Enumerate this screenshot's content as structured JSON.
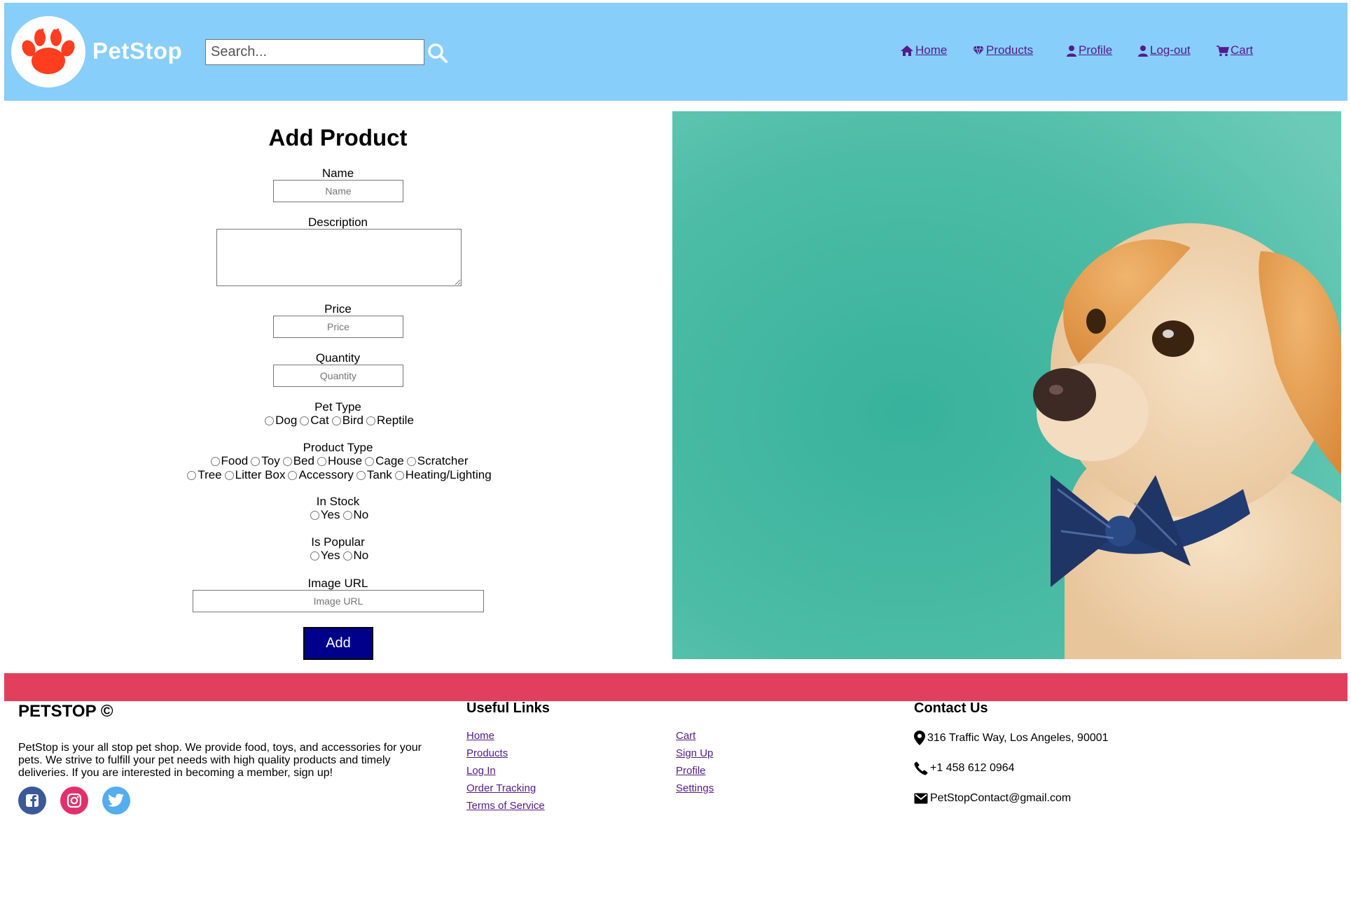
{
  "header": {
    "brand": "PetStop",
    "search": {
      "placeholder": "Search..."
    },
    "nav": [
      {
        "label": "Home",
        "icon": "home-icon"
      },
      {
        "label": "Products",
        "icon": "diamond-icon"
      },
      {
        "label": "Profile",
        "icon": "user-icon"
      },
      {
        "label": "Log-out",
        "icon": "user-icon"
      },
      {
        "label": "Cart",
        "icon": "cart-icon"
      }
    ]
  },
  "form": {
    "title": "Add Product",
    "name": {
      "label": "Name",
      "placeholder": "Name"
    },
    "description": {
      "label": "Description"
    },
    "price": {
      "label": "Price",
      "placeholder": "Price"
    },
    "quantity": {
      "label": "Quantity",
      "placeholder": "Quantity"
    },
    "pet_type": {
      "label": "Pet Type",
      "options": [
        "Dog",
        "Cat",
        "Bird",
        "Reptile"
      ]
    },
    "product_type": {
      "label": "Product Type",
      "options_row1": [
        "Food",
        "Toy",
        "Bed",
        "House",
        "Cage",
        "Scratcher"
      ],
      "options_row2": [
        "Tree",
        "Litter Box",
        "Accessory",
        "Tank",
        "Heating/Lighting"
      ]
    },
    "in_stock": {
      "label": "In Stock",
      "options": [
        "Yes",
        "No"
      ]
    },
    "is_popular": {
      "label": "Is Popular",
      "options": [
        "Yes",
        "No"
      ]
    },
    "image_url": {
      "label": "Image URL",
      "placeholder": "Image URL"
    },
    "submit_label": "Add"
  },
  "hero": {
    "subject": "puppy-with-bow-tie",
    "background": "#4dbca6"
  },
  "footer": {
    "brand": "PETSTOP ©",
    "description": "PetStop is your all stop pet shop. We provide food, toys, and accessories for your pets. We strive to fulfill your pet needs with high quality products and timely deliveries. If you are interested in becoming a member, sign up!",
    "social": [
      {
        "icon": "facebook-icon",
        "color": "#3b5998"
      },
      {
        "icon": "instagram-icon",
        "color": "#e1306c"
      },
      {
        "icon": "twitter-icon",
        "color": "#55acee"
      }
    ],
    "useful_links_title": "Useful Links",
    "links_col1": [
      "Home",
      "Products",
      "Log In",
      "Order Tracking",
      "Terms of Service"
    ],
    "links_col2": [
      "Cart",
      "Sign Up",
      "Profile",
      "Settings"
    ],
    "contact_title": "Contact Us",
    "address": "316 Traffic Way, Los Angeles, 90001",
    "phone": "+1 458 612 0964",
    "email": "PetStopContact@gmail.com"
  },
  "colors": {
    "header_bg": "#87cefa",
    "footer_bar": "#e23f5f",
    "add_button": "#00008b",
    "link": "#551a8b",
    "logo_paw": "#ff3d1f"
  }
}
